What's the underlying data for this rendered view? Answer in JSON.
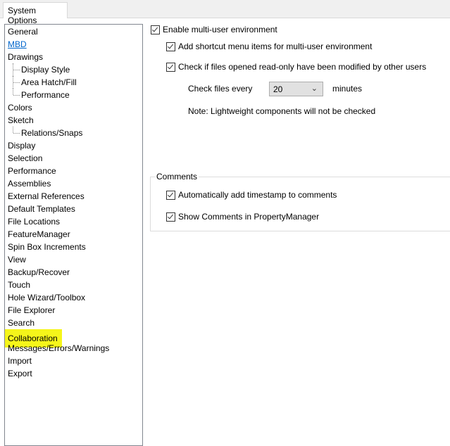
{
  "tab": {
    "label": "System Options"
  },
  "tree": {
    "items": [
      {
        "label": "General",
        "level": 0
      },
      {
        "label": "MBD",
        "level": 0,
        "link": true
      },
      {
        "label": "Drawings",
        "level": 0
      },
      {
        "label": "Display Style",
        "level": 1
      },
      {
        "label": "Area Hatch/Fill",
        "level": 1
      },
      {
        "label": "Performance",
        "level": 1,
        "last": true
      },
      {
        "label": "Colors",
        "level": 0
      },
      {
        "label": "Sketch",
        "level": 0
      },
      {
        "label": "Relations/Snaps",
        "level": 1,
        "last": true
      },
      {
        "label": "Display",
        "level": 0
      },
      {
        "label": "Selection",
        "level": 0
      },
      {
        "label": "Performance",
        "level": 0
      },
      {
        "label": "Assemblies",
        "level": 0
      },
      {
        "label": "External References",
        "level": 0
      },
      {
        "label": "Default Templates",
        "level": 0
      },
      {
        "label": "File Locations",
        "level": 0
      },
      {
        "label": "FeatureManager",
        "level": 0
      },
      {
        "label": "Spin Box Increments",
        "level": 0
      },
      {
        "label": "View",
        "level": 0
      },
      {
        "label": "Backup/Recover",
        "level": 0
      },
      {
        "label": "Touch",
        "level": 0
      },
      {
        "label": "Hole Wizard/Toolbox",
        "level": 0
      },
      {
        "label": "File Explorer",
        "level": 0
      },
      {
        "label": "Search",
        "level": 0
      },
      {
        "label": "Collaboration",
        "level": 0,
        "selected": true
      },
      {
        "label": "Messages/Errors/Warnings",
        "level": 0
      },
      {
        "label": "Import",
        "level": 0
      },
      {
        "label": "Export",
        "level": 0
      }
    ]
  },
  "options": {
    "enable_multi_user": {
      "label": "Enable multi-user environment",
      "checked": true
    },
    "add_shortcut": {
      "label": "Add shortcut menu items for multi-user environment",
      "checked": true
    },
    "check_readonly": {
      "label": "Check if files opened read-only have been modified by other users",
      "checked": true
    },
    "check_every_label": "Check files every",
    "check_every_value": "20",
    "minutes_label": "minutes",
    "note": "Note: Lightweight components will not be checked"
  },
  "comments": {
    "title": "Comments",
    "timestamp": {
      "label": "Automatically add timestamp to comments",
      "checked": true
    },
    "show_in_pm": {
      "label": "Show Comments in PropertyManager",
      "checked": true
    }
  },
  "highlight_color": "#f5f51a"
}
